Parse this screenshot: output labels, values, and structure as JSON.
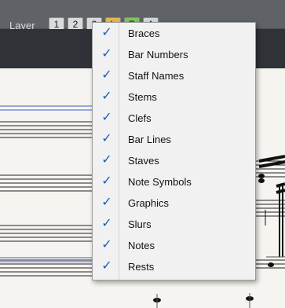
{
  "toolbar": {
    "layer_label": "Layer",
    "layer_buttons": [
      {
        "label": "1"
      },
      {
        "label": "2"
      },
      {
        "label": "3"
      },
      {
        "label": "L",
        "color": "#e6b84f"
      },
      {
        "label": "P",
        "color": "#7fc45a"
      },
      {
        "label": "A",
        "color": "#cfd8dc"
      }
    ]
  },
  "menu": {
    "check_symbol": "✓",
    "items": [
      {
        "label": "Braces",
        "checked": true
      },
      {
        "label": "Bar Numbers",
        "checked": true
      },
      {
        "label": "Staff Names",
        "checked": true
      },
      {
        "label": "Stems",
        "checked": true
      },
      {
        "label": "Clefs",
        "checked": true
      },
      {
        "label": "Bar Lines",
        "checked": true
      },
      {
        "label": "Staves",
        "checked": true
      },
      {
        "label": "Note Symbols",
        "checked": true
      },
      {
        "label": "Graphics",
        "checked": true
      },
      {
        "label": "Slurs",
        "checked": true
      },
      {
        "label": "Notes",
        "checked": true
      },
      {
        "label": "Rests",
        "checked": true
      }
    ]
  },
  "colors": {
    "check": "#1a5fb4",
    "staff_line": "#3a5fcd",
    "toolbar": "#5f6266",
    "menu_bg": "#f1f1f1"
  }
}
